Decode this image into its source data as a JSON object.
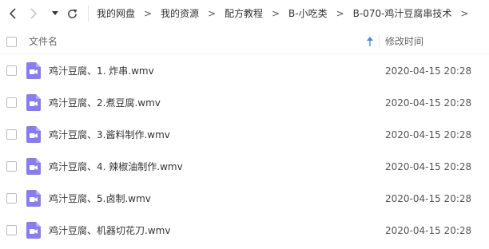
{
  "toolbar": {
    "back_icon": "chevron-left-icon",
    "forward_icon": "chevron-right-icon",
    "dropdown_icon": "caret-down-icon",
    "refresh_icon": "refresh-icon"
  },
  "breadcrumb": [
    {
      "label": "我的网盘"
    },
    {
      "label": "我的资源"
    },
    {
      "label": "配方教程"
    },
    {
      "label": "B-小吃类"
    },
    {
      "label": "B-070-鸡汁豆腐串技术"
    }
  ],
  "breadcrumb_separator": ">",
  "columns": {
    "name": "文件名",
    "modified": "修改时间",
    "sort_icon": "sort-ascending-arrow-icon"
  },
  "files": [
    {
      "name": "鸡汁豆腐、1. 炸串.wmv",
      "modified": "2020-04-15 20:28",
      "icon": "video-file-icon"
    },
    {
      "name": "鸡汁豆腐、2.煮豆腐.wmv",
      "modified": "2020-04-15 20:28",
      "icon": "video-file-icon"
    },
    {
      "name": "鸡汁豆腐、3.酱料制作.wmv",
      "modified": "2020-04-15 20:28",
      "icon": "video-file-icon"
    },
    {
      "name": "鸡汁豆腐、4. 辣椒油制作.wmv",
      "modified": "2020-04-15 20:28",
      "icon": "video-file-icon"
    },
    {
      "name": "鸡汁豆腐、5.卤制.wmv",
      "modified": "2020-04-15 20:28",
      "icon": "video-file-icon"
    },
    {
      "name": "鸡汁豆腐、机器切花刀.wmv",
      "modified": "2020-04-15 20:28",
      "icon": "video-file-icon"
    }
  ],
  "colors": {
    "video_icon": "#8a7cf0",
    "sort_arrow": "#3b8cf0"
  }
}
